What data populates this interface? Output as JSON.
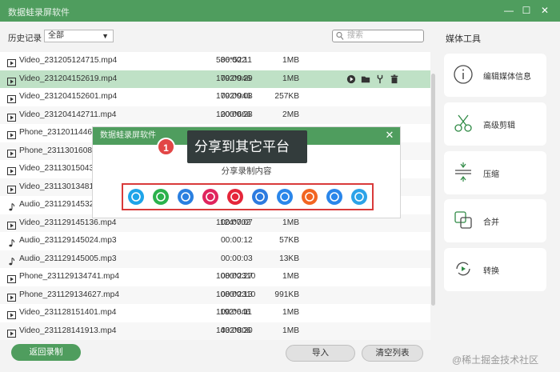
{
  "window": {
    "title": "数据蛙录屏软件",
    "controls": {
      "minimize": "—",
      "maximize": "☐",
      "close": "✕"
    }
  },
  "toolbar": {
    "history_label": "历史记录",
    "filter_value": "全部",
    "search_placeholder": "搜索"
  },
  "recordings": [
    {
      "type": "video",
      "name": "Video_231205124715.mp4",
      "resolution": "586*522",
      "duration": "00:00:11",
      "size": "1MB"
    },
    {
      "type": "video",
      "name": "Video_231204152619.mp4",
      "resolution": "1792*946",
      "duration": "00:00:29",
      "size": "1MB",
      "selected": true
    },
    {
      "type": "video",
      "name": "Video_231204152601.mp4",
      "resolution": "1792*946",
      "duration": "00:00:08",
      "size": "257KB"
    },
    {
      "type": "video",
      "name": "Video_231204142711.mp4",
      "resolution": "1200*666",
      "duration": "00:00:28",
      "size": "2MB"
    },
    {
      "type": "video",
      "name": "Phone_23120114463",
      "resolution": "",
      "duration": "",
      "size": ""
    },
    {
      "type": "video",
      "name": "Phone_23113016082",
      "resolution": "",
      "duration": "",
      "size": ""
    },
    {
      "type": "video",
      "name": "Video_23113015043",
      "resolution": "",
      "duration": "",
      "size": ""
    },
    {
      "type": "video",
      "name": "Video_23113013481",
      "resolution": "",
      "duration": "",
      "size": ""
    },
    {
      "type": "audio",
      "name": "Audio_23112914532",
      "resolution": "",
      "duration": "",
      "size": ""
    },
    {
      "type": "video",
      "name": "Video_231129145136.mp4",
      "resolution": "1124*702",
      "duration": "00:00:07",
      "size": "1MB"
    },
    {
      "type": "audio",
      "name": "Audio_231129145024.mp3",
      "resolution": "",
      "duration": "00:00:12",
      "size": "57KB"
    },
    {
      "type": "audio",
      "name": "Audio_231129145005.mp3",
      "resolution": "",
      "duration": "00:00:03",
      "size": "13KB"
    },
    {
      "type": "video",
      "name": "Phone_231129134741.mp4",
      "resolution": "1080*2310",
      "duration": "00:00:27",
      "size": "1MB"
    },
    {
      "type": "video",
      "name": "Phone_231129134627.mp4",
      "resolution": "1080*2310",
      "duration": "00:00:13",
      "size": "991KB"
    },
    {
      "type": "video",
      "name": "Video_231128151401.mp4",
      "resolution": "1192*646",
      "duration": "00:00:11",
      "size": "1MB"
    },
    {
      "type": "video",
      "name": "Video_231128141913.mp4",
      "resolution": "1432*806",
      "duration": "00:00:20",
      "size": "1MB"
    }
  ],
  "row_actions": [
    "play-icon",
    "folder-icon",
    "edit-tool-icon",
    "trash-icon"
  ],
  "media_tools": {
    "title": "媒体工具",
    "items": [
      {
        "icon": "info-icon",
        "label": "编辑媒体信息"
      },
      {
        "icon": "scissors-icon",
        "label": "高级剪辑"
      },
      {
        "icon": "compress-icon",
        "label": "压缩"
      },
      {
        "icon": "merge-icon",
        "label": "合并"
      },
      {
        "icon": "convert-icon",
        "label": "转换"
      }
    ]
  },
  "buttons": {
    "back": "返回录制",
    "import": "导入",
    "clear": "清空列表"
  },
  "share_dialog": {
    "title": "数据蛙录屏软件",
    "subtitle": "分享录制内容",
    "platforms": [
      {
        "icon": "qq-icon",
        "color": "#1ea4e9"
      },
      {
        "icon": "wechat-icon",
        "color": "#2bb24c"
      },
      {
        "icon": "bilibili-circles-icon",
        "color": "#2a7fe0"
      },
      {
        "icon": "tiktok-icon",
        "color": "#e0245e"
      },
      {
        "icon": "weibo-icon",
        "color": "#e5263a"
      },
      {
        "icon": "cloud-icon",
        "color": "#2d7be0"
      },
      {
        "icon": "play-platform-icon",
        "color": "#2a86ea"
      },
      {
        "icon": "video-platform-icon",
        "color": "#f26522"
      },
      {
        "icon": "cursor-platform-icon",
        "color": "#2a86ea"
      },
      {
        "icon": "chat-bubble-icon",
        "color": "#2ca3e8"
      }
    ]
  },
  "callout": {
    "badge": "1",
    "text": "分享到其它平台"
  },
  "watermark": "@稀土掘金技术社区",
  "colors": {
    "accent": "#4f9d5e",
    "selected_row": "#bfe1c6",
    "highlight_border": "#d93a3a"
  }
}
